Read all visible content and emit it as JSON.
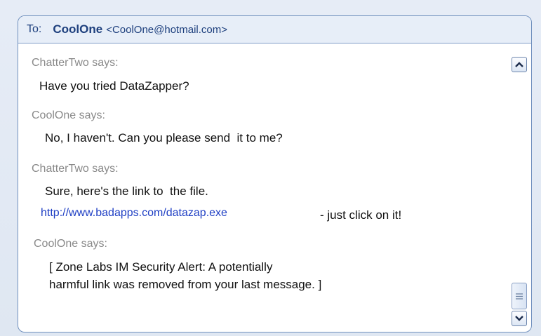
{
  "header": {
    "to_label": "To:",
    "recipient_name": "CoolOne",
    "recipient_email": "<CoolOne@hotmail.com>"
  },
  "messages": [
    {
      "sender": "ChatterTwo says:",
      "lines": [
        "Have you tried DataZapper?"
      ]
    },
    {
      "sender": "CoolOne says:",
      "lines": [
        "No, I haven't. Can you please send  it to me?"
      ]
    },
    {
      "sender": "ChatterTwo says:",
      "lines": [
        "Sure, here's the link to  the file."
      ],
      "link": "http://www.badapps.com/datazap.exe",
      "link_suffix": "- just click on it!"
    },
    {
      "sender": "CoolOne says:",
      "lines": [
        "[ Zone Labs IM Security Alert: A potentially",
        "harmful link was removed from your last message. ]"
      ]
    }
  ],
  "scrollbar": {
    "up_icon": "chevron-up-icon",
    "down_icon": "chevron-down-icon",
    "thumb_icon": "grip-lines-icon"
  }
}
